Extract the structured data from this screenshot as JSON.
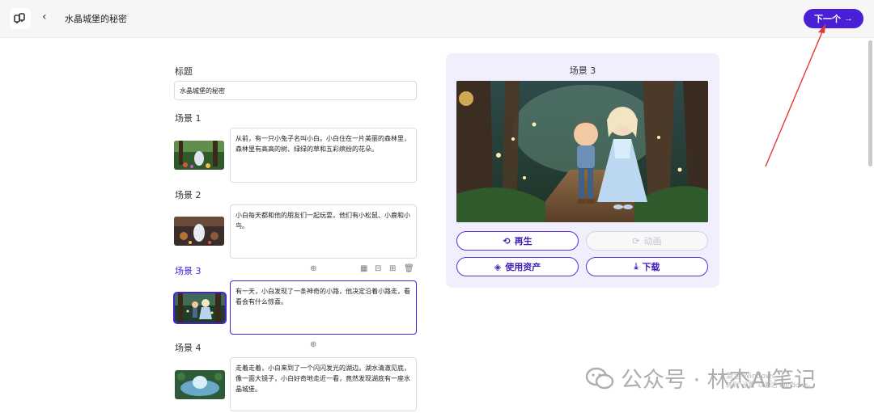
{
  "header": {
    "title": "水晶城堡的秘密",
    "back_glyph": "‹",
    "next_label": "下一个",
    "next_arrow": "→"
  },
  "form": {
    "title_label": "标题",
    "title_value": "水晶城堡的秘密",
    "scenes": [
      {
        "label": "场景 1",
        "text": "从前，有一只小兔子名叫小白。小白住在一片美丽的森林里，森林里有高高的树、绿绿的草和五彩缤纷的花朵。"
      },
      {
        "label": "场景 2",
        "text": "小白每天都和他的朋友们一起玩耍，他们有小松鼠、小鹿和小鸟。"
      },
      {
        "label": "场景 3",
        "text": "有一天，小白发现了一条神奇的小路，他决定沿着小路走，看看会有什么惊喜。"
      },
      {
        "label": "场景 4",
        "text": "走着走着，小白来到了一个闪闪发光的湖边。湖水清澈见底，像一面大镜子，小白好奇地走近一看，竟然发现湖底有一座水晶城堡。"
      }
    ]
  },
  "preview": {
    "title": "场景 3",
    "buttons": {
      "regenerate": "再生",
      "animate": "动画",
      "use_assets": "使用资产",
      "download": "下载"
    }
  },
  "watermark": {
    "text": "公众号 · 林杰AI笔记",
    "activate_line1": "激活 Windows",
    "activate_line2": "转到\"设置\"以激活 Windows。"
  },
  "colors": {
    "accent": "#4a1fd6",
    "panel_bg": "#f1eefd"
  }
}
